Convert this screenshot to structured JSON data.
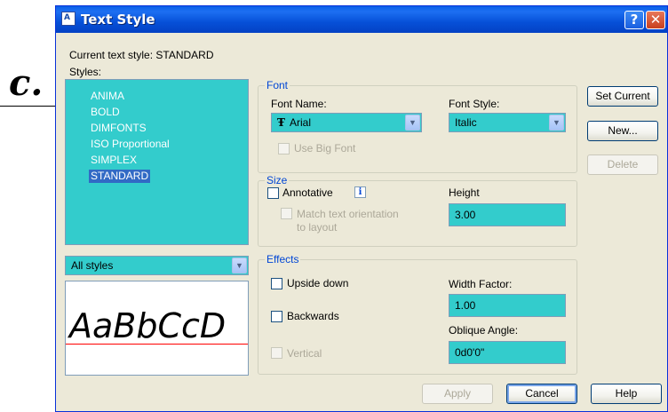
{
  "background": {
    "label": "c."
  },
  "window": {
    "title": "Text Style",
    "help_glyph": "?",
    "close_glyph": "✕"
  },
  "current_style": {
    "label": "Current text style:",
    "value": "STANDARD"
  },
  "styles": {
    "label": "Styles:",
    "items": [
      "ANIMA",
      "BOLD",
      "DIMFONTS",
      "ISO Proportional",
      "SIMPLEX",
      "STANDARD"
    ],
    "selected": "STANDARD",
    "filter_value": "All styles"
  },
  "font": {
    "legend": "Font",
    "name_label": "Font Name:",
    "name_value": "Arial",
    "style_label": "Font Style:",
    "style_value": "Italic",
    "big_font_label": "Use Big Font"
  },
  "size": {
    "legend": "Size",
    "annotative_label": "Annotative",
    "match_label_line1": "Match text orientation",
    "match_label_line2": "to layout",
    "height_label": "Height",
    "height_value": "3.00"
  },
  "effects": {
    "legend": "Effects",
    "upside_down_label": "Upside down",
    "backwards_label": "Backwards",
    "vertical_label": "Vertical",
    "width_factor_label": "Width Factor:",
    "width_factor_value": "1.00",
    "oblique_label": "Oblique Angle:",
    "oblique_value": "0d0'0\""
  },
  "preview": {
    "text": "AaBbCcD"
  },
  "buttons": {
    "set_current": "Set Current",
    "new": "New...",
    "delete": "Delete",
    "apply": "Apply",
    "cancel": "Cancel",
    "help": "Help"
  },
  "colors": {
    "field_cyan": "#33cccc",
    "selection_blue": "#316ac5",
    "title_blue": "#0a5fe7",
    "preview_baseline": "#ff0000"
  }
}
